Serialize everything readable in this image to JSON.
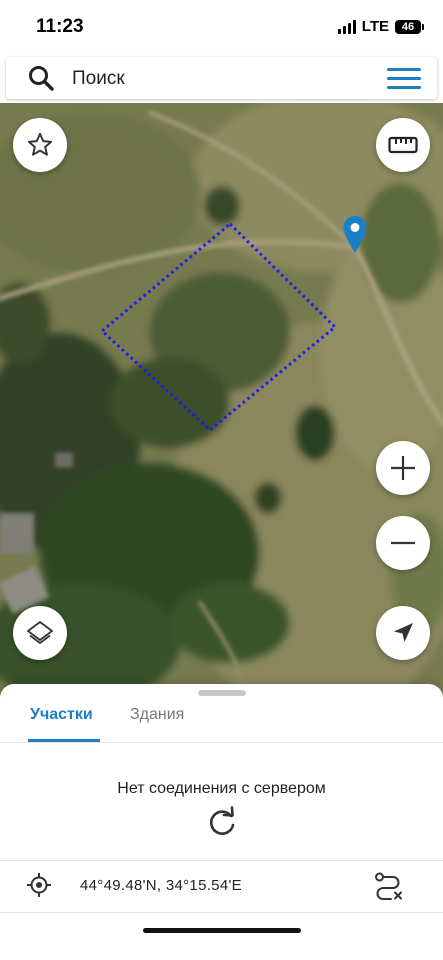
{
  "status_bar": {
    "time": "11:23",
    "network": "LTE",
    "battery": "46"
  },
  "search": {
    "placeholder": "Поиск"
  },
  "icons": {
    "search": "search-icon",
    "menu": "menu-icon",
    "favorite": "star-icon",
    "ruler": "ruler-icon",
    "zoom_in": "plus-icon",
    "zoom_out": "minus-icon",
    "layers": "layers-icon",
    "location": "navigation-arrow-icon",
    "pin": "map-pin-icon",
    "refresh": "refresh-icon",
    "crosshair": "crosshair-icon",
    "route": "route-icon"
  },
  "tabs": [
    {
      "label": "Участки",
      "active": true
    },
    {
      "label": "Здания",
      "active": false
    }
  ],
  "panel": {
    "message": "Нет соединения с сервером",
    "coordinates": "44°49.48'N, 34°15.54'E"
  },
  "colors": {
    "accent": "#1a7fc4",
    "parcel_outline": "#1a1aff"
  }
}
